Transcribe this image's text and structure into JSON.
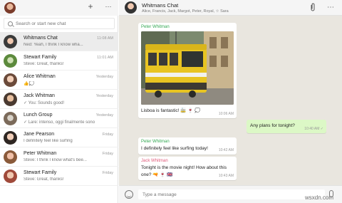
{
  "left": {
    "search_placeholder": "Search or start new chat",
    "chats": [
      {
        "name": "Whitmans Chat",
        "time": "11:08 AM",
        "preview": "Ned: Yeah, I think I know wha..."
      },
      {
        "name": "Stewart Family",
        "time": "11:01 AM",
        "preview": "Steve: Great, thanks!"
      },
      {
        "name": "Alice Whitman",
        "time": "Yesterday",
        "preview": "👍💭"
      },
      {
        "name": "Jack Whitman",
        "time": "Yesterday",
        "preview": "✓ You: Sounds good!"
      },
      {
        "name": "Lunch Group",
        "time": "Yesterday",
        "preview": "✓ Lare: intenso, oggi finalmente sono"
      },
      {
        "name": "Jane Pearson",
        "time": "Friday",
        "preview": "I definitely feel like surfing"
      },
      {
        "name": "Peter Whitman",
        "time": "Friday",
        "preview": "Steve: I think I know what's bee..."
      },
      {
        "name": "Stewart Family",
        "time": "Friday",
        "preview": "Steve: Great, thanks!"
      }
    ]
  },
  "right": {
    "title": "Whitmans Chat",
    "members": "Alice, Francis, Jack, Margot, Peter, Royal, ☆ Sara",
    "composer_placeholder": "Type a message"
  },
  "messages": {
    "m1": {
      "sender": "Peter Whitman",
      "text": "Lisboa is fantastic! 🚋 🍷 💭",
      "time": "10:06 AM"
    },
    "m2": {
      "text": "Any plans for tonight?",
      "time": "10:40 AM ✓"
    },
    "m3": {
      "sender": "Peter Whitman",
      "text": "I definitely feel like surfing today!",
      "time": "10:42 AM"
    },
    "m4": {
      "sender": "Jack Whitman",
      "text_line1": "Tonight is the movie night! How about this",
      "text_line2": "one? 🔫 🍷 🇬🇧",
      "time": "10:43 AM"
    }
  },
  "watermark": "wsxdn.com",
  "colors": {
    "sender_peter": "#33a852",
    "sender_jack": "#e05b7a",
    "tram_yellow": "#e8c422"
  }
}
